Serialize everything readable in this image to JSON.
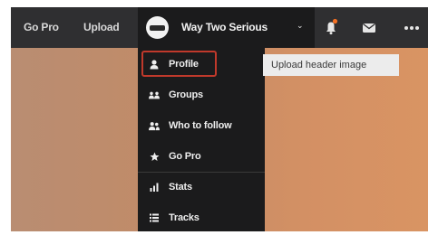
{
  "header": {
    "nav": [
      {
        "label": "Go Pro"
      },
      {
        "label": "Upload"
      }
    ],
    "user": {
      "name": "Way Two Serious"
    },
    "icons": {
      "notifications": "bell-icon",
      "messages": "mail-icon",
      "more": "more-icon",
      "chevron": "chevron-down-icon"
    }
  },
  "user_menu": {
    "items": [
      {
        "label": "Profile",
        "icon": "user-icon"
      },
      {
        "label": "Groups",
        "icon": "groups-icon"
      },
      {
        "label": "Who to follow",
        "icon": "follow-icon"
      },
      {
        "label": "Go Pro",
        "icon": "star-icon"
      },
      {
        "label": "Stats",
        "icon": "bar-chart-icon"
      },
      {
        "label": "Tracks",
        "icon": "tracks-icon"
      }
    ]
  },
  "tooltip": {
    "text": "Upload header image"
  },
  "colors": {
    "accent": "#f26f23",
    "highlight": "#c0392b",
    "topbar": "#2f2f31",
    "dropdown": "#1b1b1c"
  }
}
